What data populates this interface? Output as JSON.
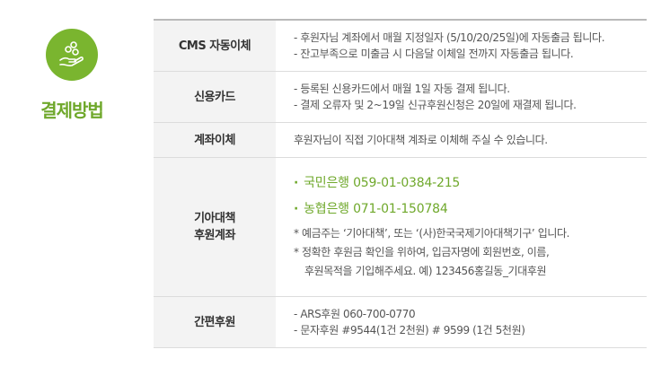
{
  "side": {
    "title": "결제방법"
  },
  "table": {
    "cms": {
      "label": "CMS 자동이체",
      "lines": [
        "- 후원자님 계좌에서 매월 지정일자 (5/10/20/25일)에 자동출금 됩니다.",
        "- 잔고부족으로 미출금 시 다음달 이체일 전까지 자동출금 됩니다."
      ]
    },
    "card": {
      "label": "신용카드",
      "lines": [
        "- 등록된 신용카드에서 매월 1일 자동 결제 됩니다.",
        "- 결제 오류자 및 2~19일 신규후원신청은 20일에 재결제 됩니다."
      ]
    },
    "transfer": {
      "label": "계좌이체",
      "text": "후원자님이 직접 기아대책 계좌로 이체해 주실 수 있습니다."
    },
    "account": {
      "label1": "기아대책",
      "label2": "후원계좌",
      "banks": [
        "국민은행 059-01-0384-215",
        "농협은행 071-01-150784"
      ],
      "note1": "* 예금주는 ‘기아대책’, 또는 ‘(사)한국국제기아대책기구’ 입니다.",
      "note2a": "* 정확한 후원금 확인을 위하여, 입금자명에 회원번호, 이름,",
      "note2b": "후원목적을 기입해주세요. 예) 123456홍길동_기대후원"
    },
    "easy": {
      "label": "간편후원",
      "lines": [
        "- ARS후원 060-700-0770",
        "- 문자후원 #9544(1건 2천원) # 9599 (1건 5천원)"
      ]
    }
  }
}
